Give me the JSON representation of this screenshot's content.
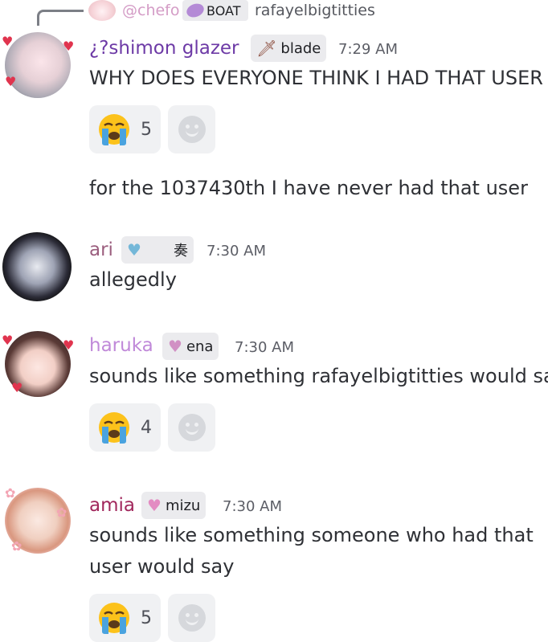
{
  "reply": {
    "username": "@chefo",
    "tag": "BOAT",
    "text": "rafayelbigtitties"
  },
  "messages": [
    {
      "username": "¿?shimon glazer",
      "name_color": "#6d3aa6",
      "tag": "blade",
      "time": "7:29 AM",
      "lines": [
        "WHY DOES EVERYONE THINK I HAD THAT USER"
      ],
      "reaction": {
        "icon": "crying-face-icon",
        "count": "5"
      },
      "followup": "for the 1037430th I have never had that user"
    },
    {
      "username": "ari",
      "name_color": "#9b5e7e",
      "tag": "奏",
      "time": "7:30 AM",
      "lines": [
        "allegedly"
      ]
    },
    {
      "username": "haruka",
      "name_color": "#c089d9",
      "tag": "ena",
      "time": "7:30 AM",
      "lines": [
        "sounds like something rafayelbigtitties would say"
      ],
      "reaction": {
        "icon": "crying-face-icon",
        "count": "4"
      }
    },
    {
      "username": "amia",
      "name_color": "#a1275c",
      "tag": "mizu",
      "time": "7:30 AM",
      "lines": [
        "sounds like something someone who had that",
        "user would say"
      ],
      "reaction": {
        "icon": "crying-face-icon",
        "count": "5"
      }
    }
  ]
}
